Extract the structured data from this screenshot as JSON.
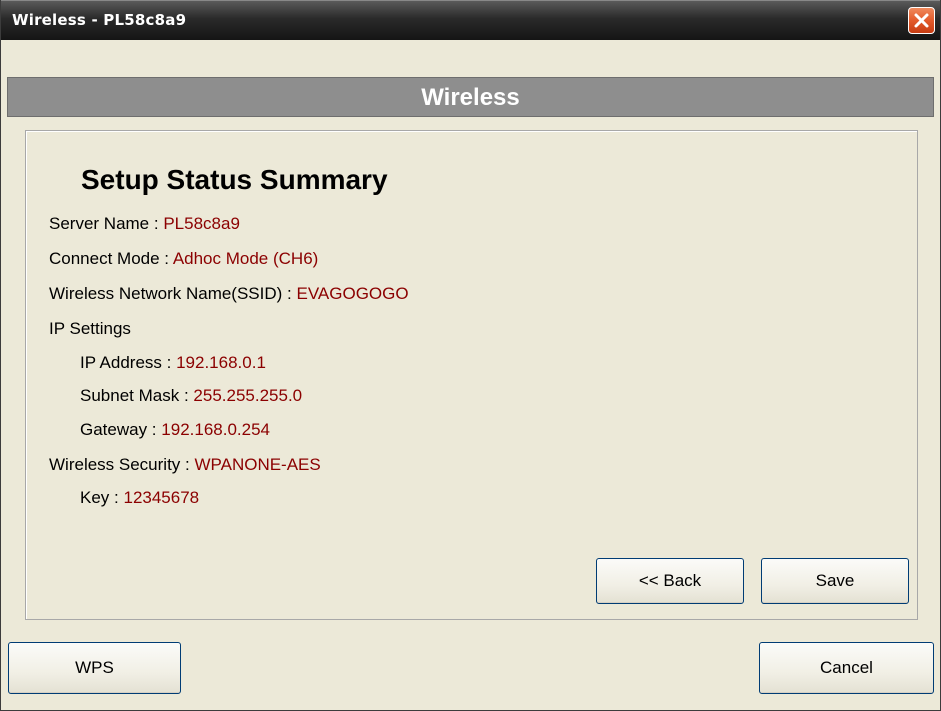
{
  "window": {
    "title": "Wireless - PL58c8a9"
  },
  "header": {
    "title": "Wireless"
  },
  "summary": {
    "title": "Setup Status Summary",
    "server_name": {
      "label": "Server Name :",
      "value": "PL58c8a9"
    },
    "connect_mode": {
      "label": "Connect Mode :",
      "value": "Adhoc Mode (CH6)"
    },
    "ssid": {
      "label": "Wireless Network Name(SSID) :",
      "value": "EVAGOGOGO"
    },
    "ip_settings": {
      "label": "IP Settings",
      "ip_address": {
        "label": "IP Address :",
        "value": "192.168.0.1"
      },
      "subnet_mask": {
        "label": "Subnet Mask :",
        "value": "255.255.255.0"
      },
      "gateway": {
        "label": "Gateway :",
        "value": "192.168.0.254"
      }
    },
    "security": {
      "label": "Wireless Security :",
      "value": "WPANONE-AES"
    },
    "key": {
      "label": "Key :",
      "value": "12345678"
    }
  },
  "buttons": {
    "back": "<< Back",
    "save": "Save",
    "wps": "WPS",
    "cancel": "Cancel"
  },
  "colors": {
    "value_text": "#8b0000",
    "header_band": "#8e8e8e",
    "close_button": "#e35a2b"
  },
  "icons": {
    "close": "close-icon"
  }
}
